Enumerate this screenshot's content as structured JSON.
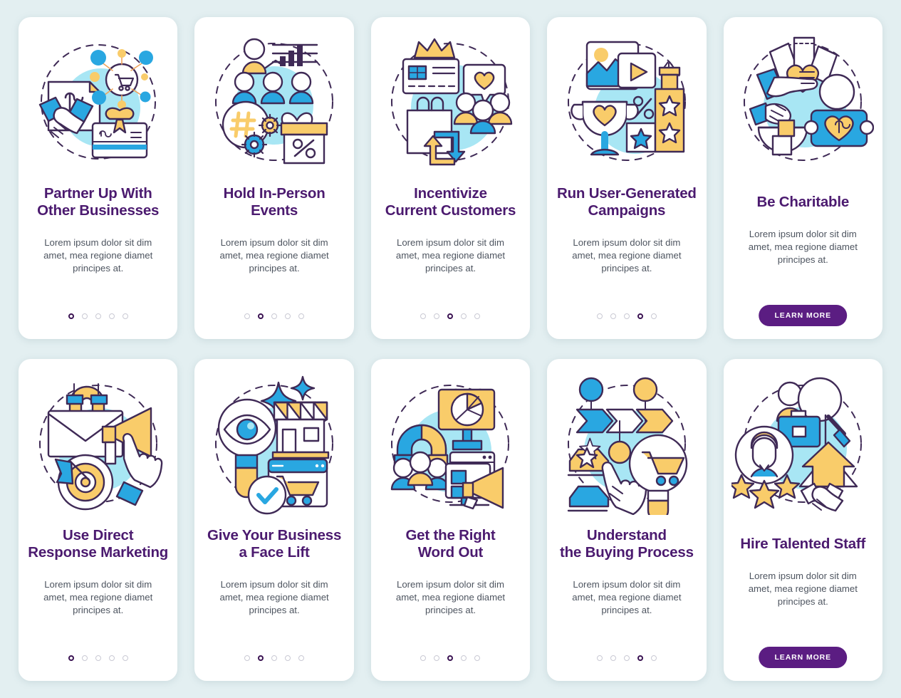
{
  "theme": {
    "background": "#e3eff1",
    "card_background": "#ffffff",
    "title_color": "#4b1a6f",
    "body_color": "#4e5560",
    "accent_blue": "#29a7e1",
    "accent_light_blue": "#a8e6f4",
    "accent_yellow": "#f9cc6a",
    "accent_purple": "#5b1d82",
    "stroke": "#3f2a56",
    "dot_inactive": "#c9c9d4",
    "dot_active": "#3b1353"
  },
  "shared": {
    "description": "Lorem ipsum dolor sit dim amet, mea regione diamet principes at.",
    "learn_more_label": "LEARN MORE",
    "dot_count": 5
  },
  "cards": [
    {
      "id": "partner-up-with-other-businesses",
      "title_line1": "Partner Up With",
      "title_line2": "Other Businesses",
      "description": "Lorem ipsum dolor sit dim amet, mea regione diamet principes at.",
      "icon_name": "handshake-network-giftcard-icon",
      "active_dot": 1,
      "has_button": false
    },
    {
      "id": "hold-in-person-events",
      "title_line1": "Hold In-Person",
      "title_line2": "Events",
      "description": "Lorem ipsum dolor sit dim amet, mea regione diamet principes at.",
      "icon_name": "presentation-hashtag-gift-icon",
      "active_dot": 2,
      "has_button": false
    },
    {
      "id": "incentivize-current-customers",
      "title_line1": "Incentivize",
      "title_line2": "Current Customers",
      "description": "Lorem ipsum dolor sit dim amet, mea regione diamet principes at.",
      "icon_name": "loyalty-card-crown-shopping-icon",
      "active_dot": 3,
      "has_button": false
    },
    {
      "id": "run-user-generated-campaigns",
      "title_line1": "Run User-Generated",
      "title_line2": "Campaigns",
      "description": "Lorem ipsum dolor sit dim amet, mea regione diamet principes at.",
      "icon_name": "trophy-video-rating-icon",
      "active_dot": 4,
      "has_button": false
    },
    {
      "id": "be-charitable",
      "title_line1": "Be Charitable",
      "title_line2": "",
      "description": "Lorem ipsum dolor sit dim amet, mea regione diamet principes at.",
      "icon_name": "donation-hands-heart-icon",
      "active_dot": 0,
      "has_button": true,
      "button_label": "LEARN MORE"
    },
    {
      "id": "use-direct-response-marketing",
      "title_line1": "Use Direct",
      "title_line2": "Response Marketing",
      "description": "Lorem ipsum dolor sit dim amet, mea regione diamet principes at.",
      "icon_name": "email-magnet-megaphone-target-icon",
      "active_dot": 1,
      "has_button": false
    },
    {
      "id": "give-your-business-a-face-lift",
      "title_line1": "Give Your Business",
      "title_line2": "a Face Lift",
      "description": "Lorem ipsum dolor sit dim amet, mea regione diamet principes at.",
      "icon_name": "magnifier-eye-storefront-icon",
      "active_dot": 2,
      "has_button": false
    },
    {
      "id": "get-the-right-word-out",
      "title_line1": "Get the Right",
      "title_line2": "Word Out",
      "description": "Lorem ipsum dolor sit dim amet, mea regione diamet principes at.",
      "icon_name": "billboard-magnet-audience-megaphone-icon",
      "active_dot": 3,
      "has_button": false
    },
    {
      "id": "understand-the-buying-process",
      "title_line1": "Understand",
      "title_line2": "the Buying Process",
      "description": "Lorem ipsum dolor sit dim amet, mea regione diamet principes at.",
      "icon_name": "buying-funnel-cart-choice-icon",
      "active_dot": 4,
      "has_button": false
    },
    {
      "id": "hire-talented-staff",
      "title_line1": "Hire Talented Staff",
      "title_line2": "",
      "description": "Lorem ipsum dolor sit dim amet, mea regione diamet principes at.",
      "icon_name": "recruitment-rating-handshake-icon",
      "active_dot": 0,
      "has_button": true,
      "button_label": "LEARN MORE"
    }
  ]
}
